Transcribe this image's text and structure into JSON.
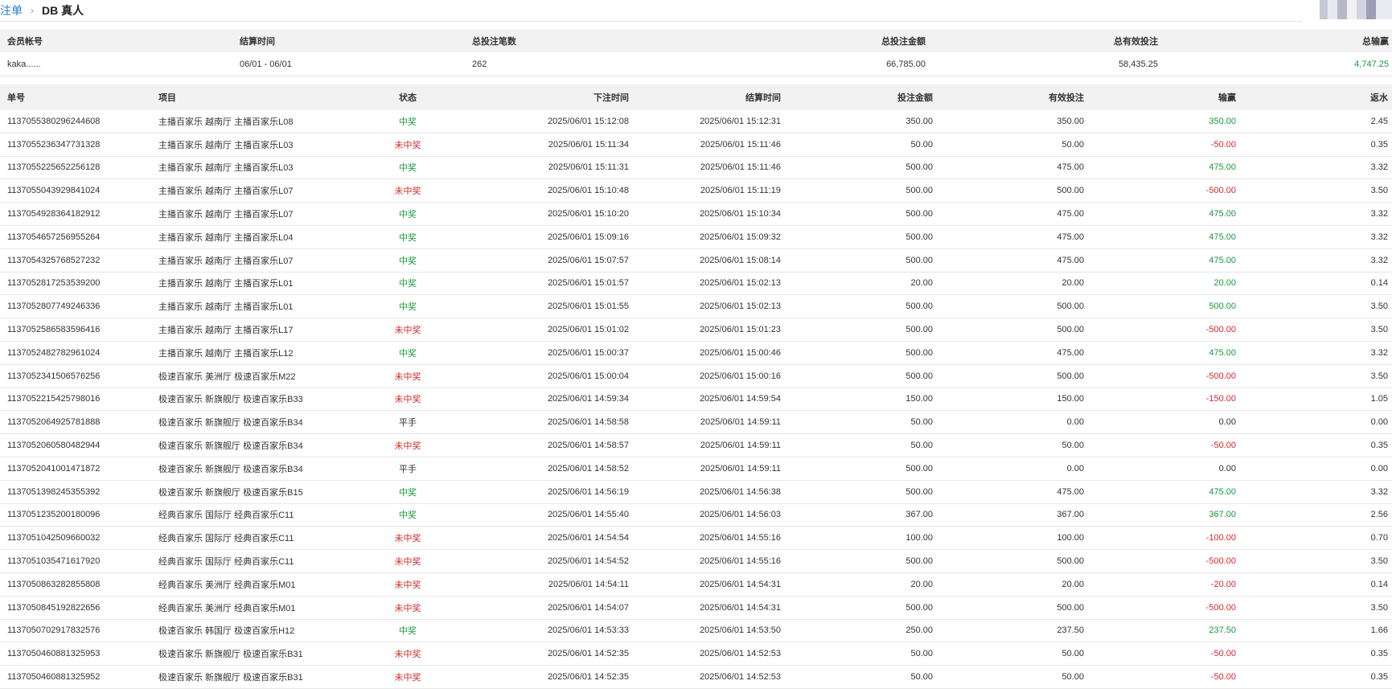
{
  "breadcrumb": {
    "parent": "注单",
    "separator": "›",
    "current": "DB 真人"
  },
  "summary": {
    "headers": [
      "会员帐号",
      "结算时间",
      "总投注笔数",
      "总投注金额",
      "总有效投注",
      "总输赢"
    ],
    "row": {
      "account": "kaka......",
      "period": "06/01 - 06/01",
      "count": "262",
      "total_bet": "66,785.00",
      "total_valid": "58,435.25",
      "total_win": "4,747.25"
    },
    "win_color": "#1a9a3a"
  },
  "table": {
    "headers": [
      "单号",
      "项目",
      "状态",
      "下注时间",
      "结算时间",
      "投注金额",
      "有效投注",
      "输赢",
      "返水"
    ],
    "rows": [
      {
        "id": "1137055380296244608",
        "item": "主播百家乐 越南厅 主播百家乐L08",
        "status": "中奖",
        "bet_time": "2025/06/01 15:12:08",
        "settle_time": "2025/06/01 15:12:31",
        "bet": "350.00",
        "valid": "350.00",
        "win": "350.00",
        "rebate": "2.45",
        "status_type": "win",
        "win_type": "win"
      },
      {
        "id": "1137055236347731328",
        "item": "主播百家乐 越南厅 主播百家乐L03",
        "status": "未中奖",
        "bet_time": "2025/06/01 15:11:34",
        "settle_time": "2025/06/01 15:11:46",
        "bet": "50.00",
        "valid": "50.00",
        "win": "-50.00",
        "rebate": "0.35",
        "status_type": "lose",
        "win_type": "lose"
      },
      {
        "id": "1137055225652256128",
        "item": "主播百家乐 越南厅 主播百家乐L03",
        "status": "中奖",
        "bet_time": "2025/06/01 15:11:31",
        "settle_time": "2025/06/01 15:11:46",
        "bet": "500.00",
        "valid": "475.00",
        "win": "475.00",
        "rebate": "3.32",
        "status_type": "win",
        "win_type": "win"
      },
      {
        "id": "1137055043929841024",
        "item": "主播百家乐 越南厅 主播百家乐L07",
        "status": "未中奖",
        "bet_time": "2025/06/01 15:10:48",
        "settle_time": "2025/06/01 15:11:19",
        "bet": "500.00",
        "valid": "500.00",
        "win": "-500.00",
        "rebate": "3.50",
        "status_type": "lose",
        "win_type": "lose"
      },
      {
        "id": "1137054928364182912",
        "item": "主播百家乐 越南厅 主播百家乐L07",
        "status": "中奖",
        "bet_time": "2025/06/01 15:10:20",
        "settle_time": "2025/06/01 15:10:34",
        "bet": "500.00",
        "valid": "475.00",
        "win": "475.00",
        "rebate": "3.32",
        "status_type": "win",
        "win_type": "win"
      },
      {
        "id": "1137054657256955264",
        "item": "主播百家乐 越南厅 主播百家乐L04",
        "status": "中奖",
        "bet_time": "2025/06/01 15:09:16",
        "settle_time": "2025/06/01 15:09:32",
        "bet": "500.00",
        "valid": "475.00",
        "win": "475.00",
        "rebate": "3.32",
        "status_type": "win",
        "win_type": "win"
      },
      {
        "id": "1137054325768527232",
        "item": "主播百家乐 越南厅 主播百家乐L07",
        "status": "中奖",
        "bet_time": "2025/06/01 15:07:57",
        "settle_time": "2025/06/01 15:08:14",
        "bet": "500.00",
        "valid": "475.00",
        "win": "475.00",
        "rebate": "3.32",
        "status_type": "win",
        "win_type": "win"
      },
      {
        "id": "1137052817253539200",
        "item": "主播百家乐 越南厅 主播百家乐L01",
        "status": "中奖",
        "bet_time": "2025/06/01 15:01:57",
        "settle_time": "2025/06/01 15:02:13",
        "bet": "20.00",
        "valid": "20.00",
        "win": "20.00",
        "rebate": "0.14",
        "status_type": "win",
        "win_type": "win"
      },
      {
        "id": "1137052807749246336",
        "item": "主播百家乐 越南厅 主播百家乐L01",
        "status": "中奖",
        "bet_time": "2025/06/01 15:01:55",
        "settle_time": "2025/06/01 15:02:13",
        "bet": "500.00",
        "valid": "500.00",
        "win": "500.00",
        "rebate": "3.50",
        "status_type": "win",
        "win_type": "win"
      },
      {
        "id": "1137052586583596416",
        "item": "主播百家乐 越南厅 主播百家乐L17",
        "status": "未中奖",
        "bet_time": "2025/06/01 15:01:02",
        "settle_time": "2025/06/01 15:01:23",
        "bet": "500.00",
        "valid": "500.00",
        "win": "-500.00",
        "rebate": "3.50",
        "status_type": "lose",
        "win_type": "lose"
      },
      {
        "id": "1137052482782961024",
        "item": "主播百家乐 越南厅 主播百家乐L12",
        "status": "中奖",
        "bet_time": "2025/06/01 15:00:37",
        "settle_time": "2025/06/01 15:00:46",
        "bet": "500.00",
        "valid": "475.00",
        "win": "475.00",
        "rebate": "3.32",
        "status_type": "win",
        "win_type": "win"
      },
      {
        "id": "1137052341506576256",
        "item": "极速百家乐 美洲厅 极速百家乐M22",
        "status": "未中奖",
        "bet_time": "2025/06/01 15:00:04",
        "settle_time": "2025/06/01 15:00:16",
        "bet": "500.00",
        "valid": "500.00",
        "win": "-500.00",
        "rebate": "3.50",
        "status_type": "lose",
        "win_type": "lose"
      },
      {
        "id": "1137052215425798016",
        "item": "极速百家乐 新旗舰厅 极速百家乐B33",
        "status": "未中奖",
        "bet_time": "2025/06/01 14:59:34",
        "settle_time": "2025/06/01 14:59:54",
        "bet": "150.00",
        "valid": "150.00",
        "win": "-150.00",
        "rebate": "1.05",
        "status_type": "lose",
        "win_type": "lose"
      },
      {
        "id": "1137052064925781888",
        "item": "极速百家乐 新旗舰厅 极速百家乐B34",
        "status": "平手",
        "bet_time": "2025/06/01 14:58:58",
        "settle_time": "2025/06/01 14:59:11",
        "bet": "50.00",
        "valid": "0.00",
        "win": "0.00",
        "rebate": "0.00",
        "status_type": "tie",
        "win_type": "tie"
      },
      {
        "id": "1137052060580482944",
        "item": "极速百家乐 新旗舰厅 极速百家乐B34",
        "status": "未中奖",
        "bet_time": "2025/06/01 14:58:57",
        "settle_time": "2025/06/01 14:59:11",
        "bet": "50.00",
        "valid": "50.00",
        "win": "-50.00",
        "rebate": "0.35",
        "status_type": "lose",
        "win_type": "lose"
      },
      {
        "id": "1137052041001471872",
        "item": "极速百家乐 新旗舰厅 极速百家乐B34",
        "status": "平手",
        "bet_time": "2025/06/01 14:58:52",
        "settle_time": "2025/06/01 14:59:11",
        "bet": "500.00",
        "valid": "0.00",
        "win": "0.00",
        "rebate": "0.00",
        "status_type": "tie",
        "win_type": "tie"
      },
      {
        "id": "1137051398245355392",
        "item": "极速百家乐 新旗舰厅 极速百家乐B15",
        "status": "中奖",
        "bet_time": "2025/06/01 14:56:19",
        "settle_time": "2025/06/01 14:56:38",
        "bet": "500.00",
        "valid": "475.00",
        "win": "475.00",
        "rebate": "3.32",
        "status_type": "win",
        "win_type": "win"
      },
      {
        "id": "1137051235200180096",
        "item": "经典百家乐 国际厅 经典百家乐C11",
        "status": "中奖",
        "bet_time": "2025/06/01 14:55:40",
        "settle_time": "2025/06/01 14:56:03",
        "bet": "367.00",
        "valid": "367.00",
        "win": "367.00",
        "rebate": "2.56",
        "status_type": "win",
        "win_type": "win"
      },
      {
        "id": "1137051042509660032",
        "item": "经典百家乐 国际厅 经典百家乐C11",
        "status": "未中奖",
        "bet_time": "2025/06/01 14:54:54",
        "settle_time": "2025/06/01 14:55:16",
        "bet": "100.00",
        "valid": "100.00",
        "win": "-100.00",
        "rebate": "0.70",
        "status_type": "lose",
        "win_type": "lose"
      },
      {
        "id": "1137051035471617920",
        "item": "经典百家乐 国际厅 经典百家乐C11",
        "status": "未中奖",
        "bet_time": "2025/06/01 14:54:52",
        "settle_time": "2025/06/01 14:55:16",
        "bet": "500.00",
        "valid": "500.00",
        "win": "-500.00",
        "rebate": "3.50",
        "status_type": "lose",
        "win_type": "lose"
      },
      {
        "id": "1137050863282855808",
        "item": "经典百家乐 美洲厅 经典百家乐M01",
        "status": "未中奖",
        "bet_time": "2025/06/01 14:54:11",
        "settle_time": "2025/06/01 14:54:31",
        "bet": "20.00",
        "valid": "20.00",
        "win": "-20.00",
        "rebate": "0.14",
        "status_type": "lose",
        "win_type": "lose"
      },
      {
        "id": "1137050845192822656",
        "item": "经典百家乐 美洲厅 经典百家乐M01",
        "status": "未中奖",
        "bet_time": "2025/06/01 14:54:07",
        "settle_time": "2025/06/01 14:54:31",
        "bet": "500.00",
        "valid": "500.00",
        "win": "-500.00",
        "rebate": "3.50",
        "status_type": "lose",
        "win_type": "lose"
      },
      {
        "id": "1137050702917832576",
        "item": "极速百家乐 韩国厅 极速百家乐H12",
        "status": "中奖",
        "bet_time": "2025/06/01 14:53:33",
        "settle_time": "2025/06/01 14:53:50",
        "bet": "250.00",
        "valid": "237.50",
        "win": "237.50",
        "rebate": "1.66",
        "status_type": "win",
        "win_type": "win"
      },
      {
        "id": "1137050460881325953",
        "item": "极速百家乐 新旗舰厅 极速百家乐B31",
        "status": "未中奖",
        "bet_time": "2025/06/01 14:52:35",
        "settle_time": "2025/06/01 14:52:53",
        "bet": "50.00",
        "valid": "50.00",
        "win": "-50.00",
        "rebate": "0.35",
        "status_type": "lose",
        "win_type": "lose"
      },
      {
        "id": "1137050460881325952",
        "item": "极速百家乐 新旗舰厅 极速百家乐B31",
        "status": "未中奖",
        "bet_time": "2025/06/01 14:52:35",
        "settle_time": "2025/06/01 14:52:53",
        "bet": "50.00",
        "valid": "50.00",
        "win": "-50.00",
        "rebate": "0.35",
        "status_type": "lose",
        "win_type": "lose"
      }
    ]
  },
  "colors": {
    "win": "#1a9a3a",
    "lose": "#d12b2b",
    "tie": "#333333",
    "link": "#1e7fd6"
  }
}
